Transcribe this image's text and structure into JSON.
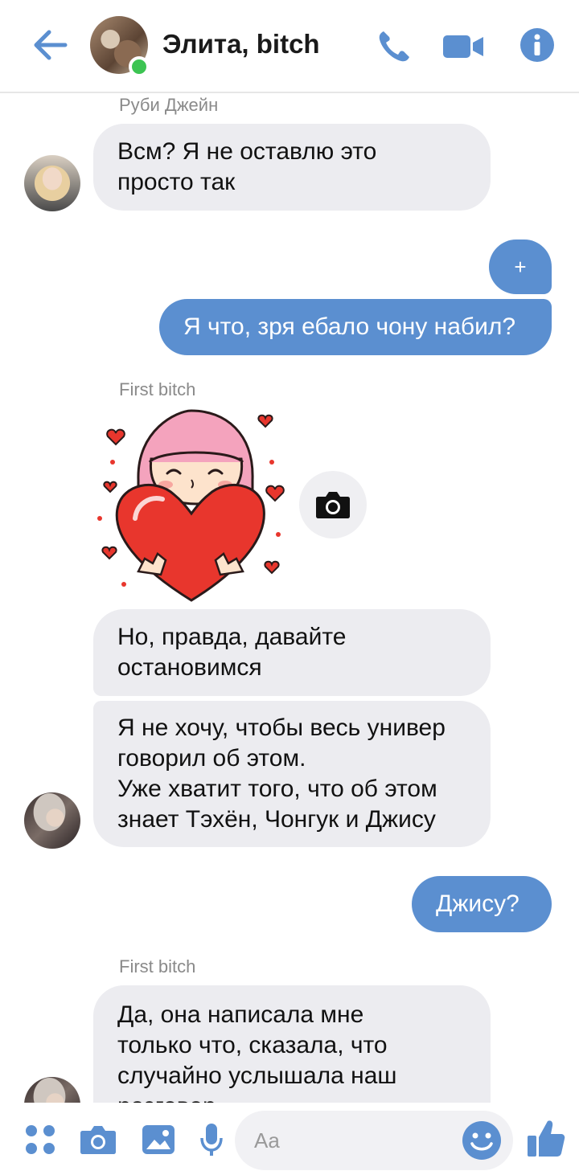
{
  "header": {
    "title": "Элита, bitch",
    "accent": "#5b8fd0",
    "icons": [
      "back-arrow-icon",
      "phone-icon",
      "video-camera-icon",
      "info-icon"
    ]
  },
  "messages": [
    {
      "sender": "Руби Джейн",
      "direction": "in",
      "lines": [
        "Всм? Я не оставлю это",
        "просто так"
      ]
    },
    {
      "direction": "out",
      "lines": [
        "+"
      ]
    },
    {
      "direction": "out",
      "lines": [
        "Я что, зря ебало чону набил?"
      ]
    },
    {
      "sender": "First bitch",
      "direction": "in",
      "type": "sticker"
    },
    {
      "direction": "in",
      "lines": [
        "Но, правда, давайте",
        "остановимся"
      ]
    },
    {
      "direction": "in",
      "lines": [
        "Я не хочу, чтобы весь универ",
        "говорил об этом.",
        "Уже хватит того, что об этом",
        "знает Тэхён, Чонгук и Джису"
      ]
    },
    {
      "direction": "out",
      "lines": [
        "Джису?"
      ]
    },
    {
      "sender": "First bitch",
      "direction": "in",
      "lines": [
        "Да, она написала мне",
        "только что, сказала, что",
        "случайно услышала наш",
        "разговор"
      ]
    }
  ],
  "composer": {
    "placeholder": "Aa",
    "icons": [
      "apps-icon",
      "camera-icon",
      "gallery-icon",
      "microphone-icon",
      "emoji-icon",
      "thumbs-up-icon"
    ]
  },
  "colors": {
    "incoming_bubble": "#ececf0",
    "outgoing_bubble": "#5b8fd0",
    "online": "#3cc452"
  }
}
